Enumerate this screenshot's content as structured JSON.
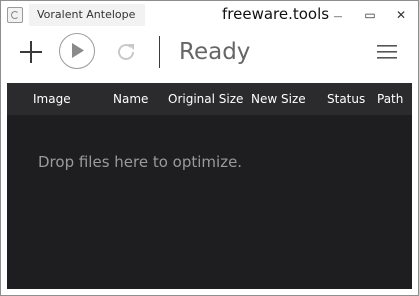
{
  "titlebar": {
    "app_name": "Voralent Antelope",
    "site": "freeware.tools",
    "minimize_glyph": "—",
    "maximize_glyph": "▭",
    "close_glyph": "✕"
  },
  "toolbar": {
    "add_icon": "plus-icon",
    "play_icon": "play-icon",
    "refresh_icon": "refresh-icon",
    "status": "Ready",
    "menu_icon": "hamburger-menu-icon"
  },
  "table": {
    "columns": [
      "Image",
      "Name",
      "Original Size",
      "New Size",
      "Status",
      "Path"
    ]
  },
  "dropzone": {
    "text": "Drop files here to optimize."
  },
  "colors": {
    "panel_bg": "#1e1e20",
    "header_bg": "#2b2b2e",
    "drop_text": "#9a9a9a"
  }
}
